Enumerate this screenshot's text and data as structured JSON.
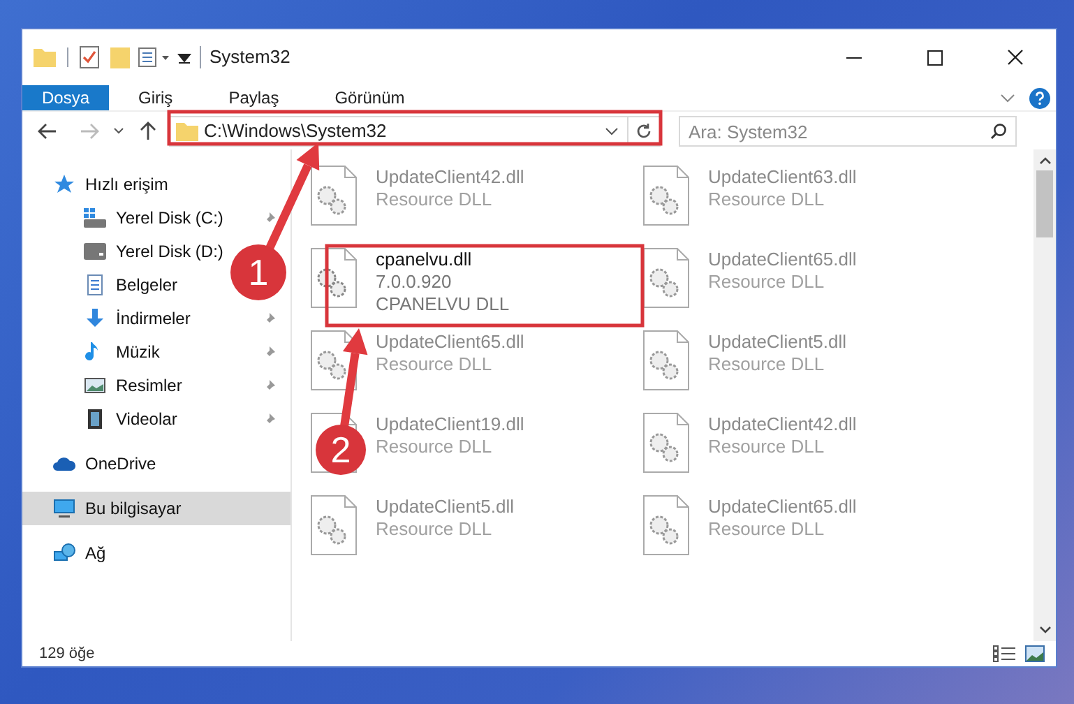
{
  "window": {
    "title": "System32"
  },
  "ribbon_tabs": [
    {
      "label": "Dosya",
      "selected": true
    },
    {
      "label": "Giriş",
      "selected": false
    },
    {
      "label": "Paylaş",
      "selected": false
    },
    {
      "label": "Görünüm",
      "selected": false
    }
  ],
  "address_bar": {
    "path": "C:\\Windows\\System32"
  },
  "search": {
    "placeholder": "Ara: System32"
  },
  "sidebar": {
    "items": [
      {
        "label": "Hızlı erişim",
        "kind": "star",
        "selected": false,
        "children": [
          {
            "label": "Yerel Disk (C:)",
            "kind": "drive-c",
            "pinned": true,
            "selected": false
          },
          {
            "label": "Yerel Disk (D:)",
            "kind": "drive",
            "pinned": false,
            "selected": false
          },
          {
            "label": "Belgeler",
            "kind": "doc",
            "pinned": false,
            "selected": false
          },
          {
            "label": "İndirmeler",
            "kind": "download",
            "pinned": true,
            "selected": false
          },
          {
            "label": "Müzik",
            "kind": "music",
            "pinned": true,
            "selected": false
          },
          {
            "label": "Resimler",
            "kind": "pictures",
            "pinned": true,
            "selected": false
          },
          {
            "label": "Videolar",
            "kind": "video",
            "pinned": true,
            "selected": false
          }
        ]
      },
      {
        "label": "OneDrive",
        "kind": "cloud",
        "selected": false
      },
      {
        "label": "Bu bilgisayar",
        "kind": "pc",
        "selected": true
      },
      {
        "label": "Ağ",
        "kind": "network",
        "selected": false
      }
    ]
  },
  "files": [
    {
      "name": "UpdateClient42.dll",
      "lines": [
        "Resource DLL"
      ],
      "kind": "blurred"
    },
    {
      "name": "UpdateClient63.dll",
      "lines": [
        "Resource DLL"
      ],
      "kind": "blurred"
    },
    {
      "name": "cpanelvu.dll",
      "lines": [
        "7.0.0.920",
        "CPANELVU DLL"
      ],
      "kind": "focus"
    },
    {
      "name": "UpdateClient65.dll",
      "lines": [
        "Resource DLL"
      ],
      "kind": "blurred"
    },
    {
      "name": "UpdateClient65.dll",
      "lines": [
        "Resource DLL"
      ],
      "kind": "blurred"
    },
    {
      "name": "UpdateClient5.dll",
      "lines": [
        "Resource DLL"
      ],
      "kind": "blurred"
    },
    {
      "name": "UpdateClient19.dll",
      "lines": [
        "Resource DLL"
      ],
      "kind": "blurred"
    },
    {
      "name": "UpdateClient42.dll",
      "lines": [
        "Resource DLL"
      ],
      "kind": "blurred"
    },
    {
      "name": "UpdateClient5.dll",
      "lines": [
        "Resource DLL"
      ],
      "kind": "blurred"
    },
    {
      "name": "UpdateClient65.dll",
      "lines": [
        "Resource DLL"
      ],
      "kind": "blurred"
    }
  ],
  "status_bar": {
    "count": "129 öğe"
  },
  "annotations": [
    {
      "label": "1"
    },
    {
      "label": "2"
    }
  ]
}
